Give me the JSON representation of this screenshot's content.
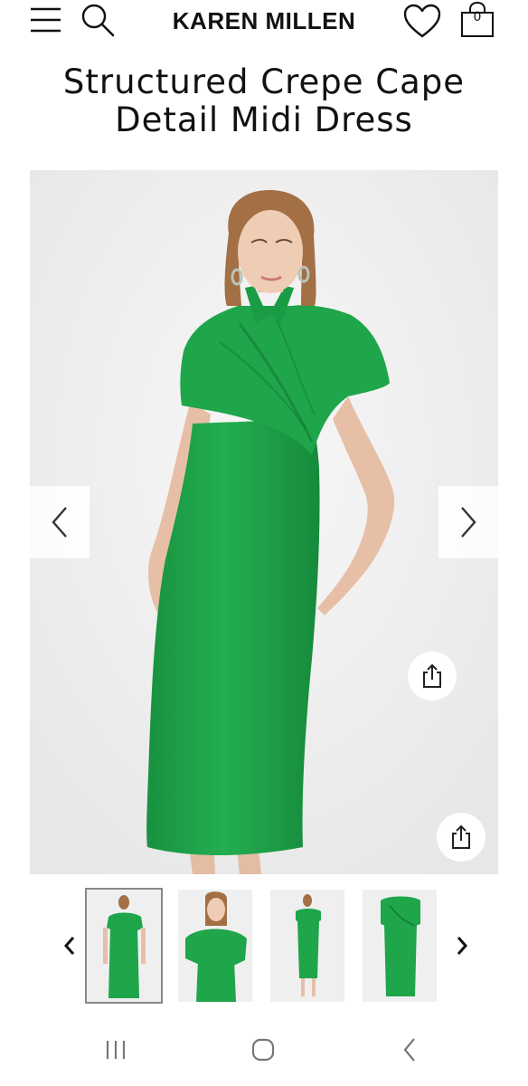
{
  "header": {
    "brand": "KAREN MILLEN",
    "bag_count": "0",
    "icons": [
      "menu-icon",
      "search-icon",
      "heart-icon",
      "shopping-bag-icon"
    ]
  },
  "product": {
    "title": "Structured Crepe Cape Detail Midi Dress",
    "dress_color": "#1fa54a",
    "background_color": "#efefef"
  },
  "gallery": {
    "prev_icon": "chevron-left-icon",
    "next_icon": "chevron-right-icon",
    "share_icon": "share-icon",
    "thumbnails_count": 4,
    "selected_thumbnail": 1
  },
  "android_nav": {
    "icons": [
      "recent-apps-icon",
      "home-icon",
      "back-icon"
    ]
  }
}
